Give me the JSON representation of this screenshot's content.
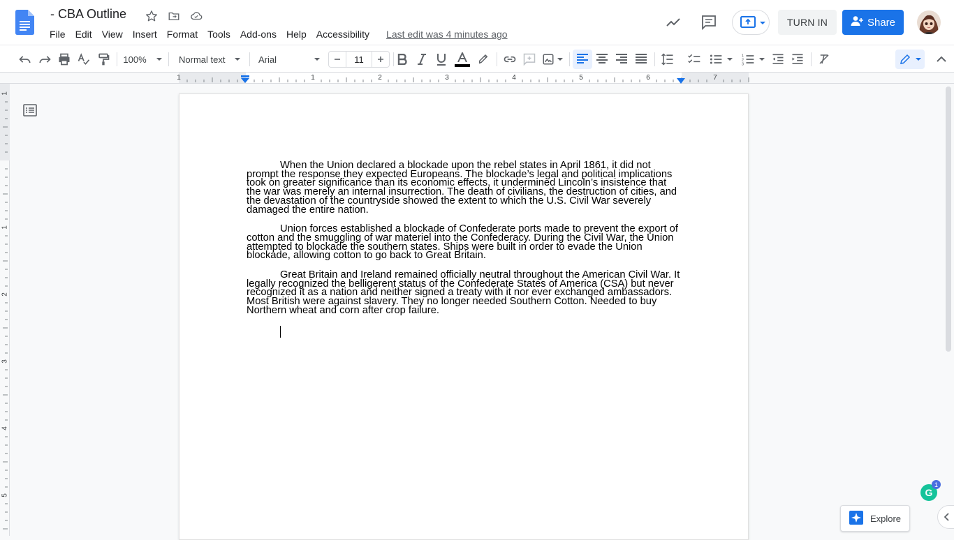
{
  "app": {
    "brand_color": "#1a73e8",
    "doc_icon_color": "#4285f4"
  },
  "header": {
    "title": "- CBA Outline",
    "menus": [
      "File",
      "Edit",
      "View",
      "Insert",
      "Format",
      "Tools",
      "Add-ons",
      "Help",
      "Accessibility"
    ],
    "last_edit": "Last edit was 4 minutes ago",
    "turn_in": "TURN IN",
    "share": "Share"
  },
  "toolbar": {
    "zoom": "100%",
    "style": "Normal text",
    "font": "Arial",
    "font_size": "11",
    "icons": [
      "undo-icon",
      "redo-icon",
      "print-icon",
      "spellcheck-icon",
      "paint-format-icon",
      "bold-icon",
      "italic-icon",
      "underline-icon",
      "text-color-icon",
      "highlight-icon",
      "link-icon",
      "add-comment-icon",
      "insert-image-icon",
      "align-left-icon",
      "align-center-icon",
      "align-right-icon",
      "justify-icon",
      "line-spacing-icon",
      "checklist-icon",
      "bulleted-list-icon",
      "numbered-list-icon",
      "decrease-indent-icon",
      "increase-indent-icon",
      "clear-formatting-icon",
      "editing-mode-icon",
      "collapse-menus-icon"
    ]
  },
  "ruler": {
    "h_numbers": [
      "1",
      "1",
      "2",
      "3",
      "4",
      "5",
      "6",
      "7"
    ],
    "v_numbers": [
      "1",
      "1",
      "2",
      "3",
      "4",
      "5"
    ]
  },
  "document": {
    "paragraphs": [
      "When the Union declared a blockade upon the rebel states in April 1861, it did not prompt the response they expected Europeans. The blockade’s legal and political implications took on greater significance than its economic effects, it undermined Lincoln’s insistence that the war was merely an internal insurrection. The death of civilians, the destruction of cities, and the devastation of the countryside showed the extent to which the U.S. Civil War severely damaged the entire nation.",
      "Union forces established a blockade of Confederate ports made to prevent the export of cotton and the smuggling of war materiel into the Confederacy. During the Civil War, the Union attempted to blockade the southern states. Ships were built in order to evade the Union blockade, allowing cotton to go back to Great Britain.",
      "Great Britain and Ireland remained officially neutral throughout the American Civil War. It legally recognized the belligerent status of the Confederate States of America (CSA) but never recognized it as a nation and neither signed a treaty with it nor ever exchanged ambassadors. Most British were against slavery. They no longer needed Southern Cotton. Needed to buy Northern wheat and corn after crop failure."
    ]
  },
  "side": {
    "explore": "Explore",
    "grammarly_badge": "1",
    "grammarly_letter": "G"
  }
}
